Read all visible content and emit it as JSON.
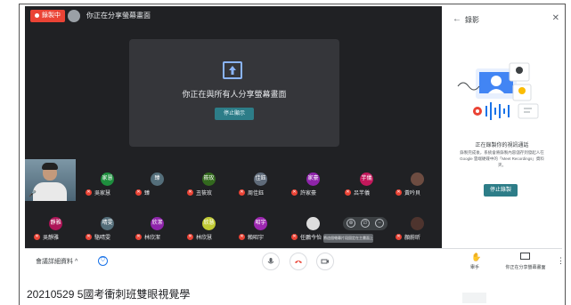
{
  "meet": {
    "recording_badge": "錄製中",
    "sharing_title": "你正在分享螢幕畫面",
    "stage_message": "你正在與所有人分享螢幕畫面",
    "stop_presenting": "停止顯示"
  },
  "participants": [
    {
      "avatar": "家慧",
      "name": "吳家慧",
      "color": "#1e8e3e"
    },
    {
      "avatar": "臻",
      "name": "臻",
      "color": "#546e7a"
    },
    {
      "avatar": "筱玫",
      "name": "丑筱玫",
      "color": "#33691e"
    },
    {
      "avatar": "佳鈺",
      "name": "周佳鈺",
      "color": "#5f6b7a"
    },
    {
      "avatar": "家豪",
      "name": "許家豪",
      "color": "#8e24aa"
    },
    {
      "avatar": "芋儀",
      "name": "呂芊儀",
      "color": "#c2185b"
    },
    {
      "avatar": "",
      "name": "黃吟貝",
      "color": "#6d4c41"
    },
    {
      "avatar": "靜雅",
      "name": "吳靜雅",
      "color": "#ad1457"
    },
    {
      "avatar": "晴雯",
      "name": "駱晴雯",
      "color": "#546e7a"
    },
    {
      "avatar": "欣潔",
      "name": "林欣潔",
      "color": "#8e24aa"
    },
    {
      "avatar": "欣慧",
      "name": "林欣慧",
      "color": "#c0ca33"
    },
    {
      "avatar": "昭宇",
      "name": "賴昭宇",
      "color": "#9c27b0"
    },
    {
      "avatar": "",
      "name": "任鵬今怡",
      "color": "#dddddd"
    },
    {
      "avatar": "",
      "name": "",
      "color": "#3c4043"
    },
    {
      "avatar": "",
      "name": "顏蔚昕",
      "color": "#4e342e"
    }
  ],
  "tooltip": "將這個螢幕片段固定在主畫面上",
  "panel": {
    "back_icon": "arrow-left-icon",
    "title": "錄影",
    "heading": "正在錄製你的視訊通話",
    "description": "錄製完成後，系統會將錄製內容儲存到發起人在 Google 雲端硬碟中的「Meet Recordings」資料夾。",
    "stop_recording": "停止錄製"
  },
  "bottombar": {
    "details_label": "會議詳細資料",
    "raise_hand_label": "舉手",
    "present_label": "你正在分享螢幕畫面",
    "end_call_color": "#ea4335"
  },
  "caption": "20210529 5國考衝刺班雙眼視覺學"
}
